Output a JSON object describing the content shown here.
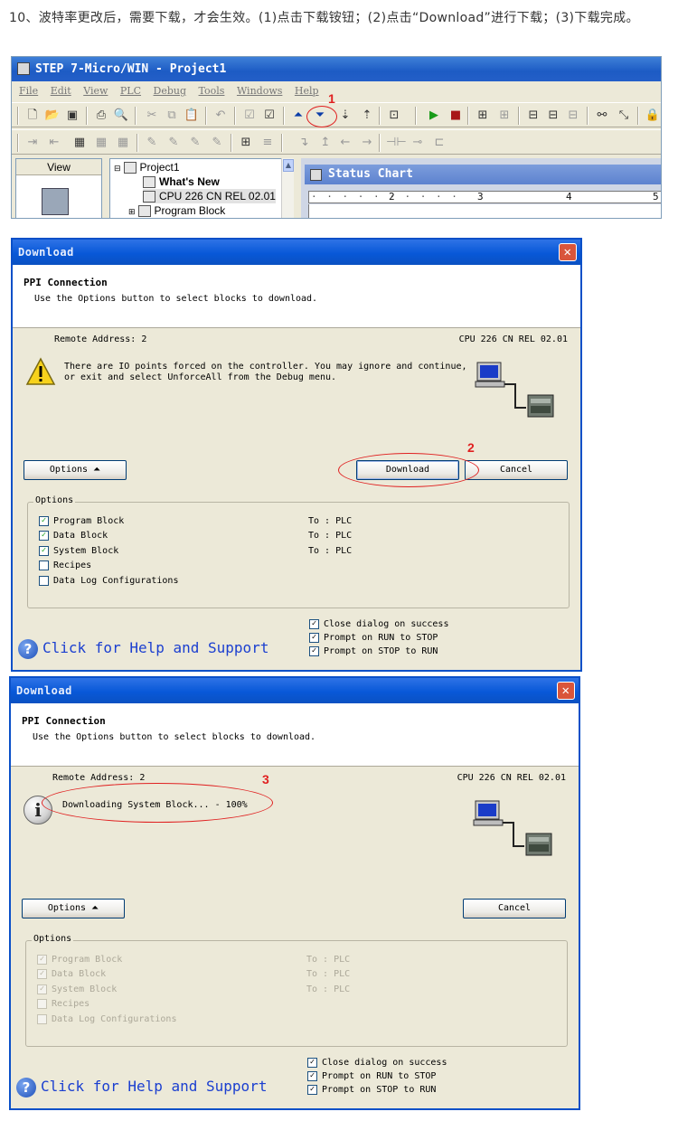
{
  "intro_text": "10、波特率更改后，需要下载，才会生效。(1)点击下载铵钮；(2)点击“Download”进行下载；(3)下载完成。",
  "step7": {
    "title": "STEP 7-Micro/WIN - Project1",
    "menu": [
      "File",
      "Edit",
      "View",
      "PLC",
      "Debug",
      "Tools",
      "Windows",
      "Help"
    ],
    "view_label": "View",
    "tree": [
      "Project1",
      "What's New",
      "CPU 226 CN REL 02.01",
      "Program Block"
    ],
    "status_chart_title": "Status Chart",
    "ruler": [
      "2",
      "3",
      "4",
      "5"
    ],
    "marker": "1"
  },
  "dialog1": {
    "title": "Download",
    "heading": "PPI Connection",
    "subheading": "Use the Options button to select blocks to download.",
    "remote_address": "Remote Address: 2",
    "cpu": "CPU 226 CN REL 02.01",
    "message_line1": "There are IO points forced on the controller. You may ignore and continue,",
    "message_line2": "or exit and select UnforceAll from the Debug menu.",
    "options_button": "Options ⏶",
    "download_button": "Download",
    "cancel_button": "Cancel",
    "marker": "2",
    "options_label": "Options",
    "options": [
      {
        "label": "Program Block",
        "checked": true,
        "target": "To : PLC"
      },
      {
        "label": "Data Block",
        "checked": true,
        "target": "To : PLC"
      },
      {
        "label": "System Block",
        "checked": true,
        "target": "To : PLC"
      },
      {
        "label": "Recipes",
        "checked": false,
        "target": ""
      },
      {
        "label": "Data Log Configurations",
        "checked": false,
        "target": ""
      }
    ],
    "settings": [
      {
        "label": "Close dialog on success",
        "checked": true
      },
      {
        "label": "Prompt on RUN to STOP",
        "checked": true
      },
      {
        "label": "Prompt on STOP to RUN",
        "checked": true
      }
    ],
    "help": "Click for Help and Support"
  },
  "dialog2": {
    "title": "Download",
    "heading": "PPI Connection",
    "subheading": "Use the Options button to select blocks to download.",
    "remote_address": "Remote Address: 2",
    "cpu": "CPU 226 CN REL 02.01",
    "progress_message": "Downloading System Block... - 100%",
    "options_button": "Options ⏶",
    "cancel_button": "Cancel",
    "marker": "3",
    "options_label": "Options",
    "options": [
      {
        "label": "Program Block",
        "checked": true,
        "target": "To : PLC"
      },
      {
        "label": "Data Block",
        "checked": true,
        "target": "To : PLC"
      },
      {
        "label": "System Block",
        "checked": true,
        "target": "To : PLC"
      },
      {
        "label": "Recipes",
        "checked": false,
        "target": ""
      },
      {
        "label": "Data Log Configurations",
        "checked": false,
        "target": ""
      }
    ],
    "settings": [
      {
        "label": "Close dialog on success",
        "checked": true
      },
      {
        "label": "Prompt on RUN to STOP",
        "checked": true
      },
      {
        "label": "Prompt on STOP to RUN",
        "checked": true
      }
    ],
    "help": "Click for Help and Support"
  },
  "colors": {
    "title_bar": "#0a51c2",
    "annotation_red": "#e02020",
    "check_green": "#21a121",
    "help_link": "#1b3fd0"
  }
}
